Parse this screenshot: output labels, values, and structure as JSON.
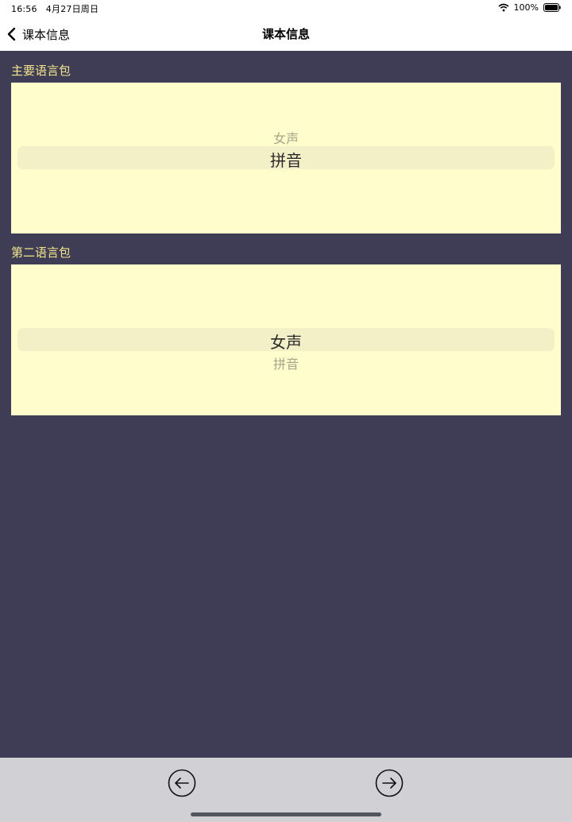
{
  "status_bar": {
    "time": "16:56",
    "date": "4月27日周日",
    "battery_percent": "100%",
    "wifi_icon": "wifi-icon",
    "battery_icon": "battery-full-icon"
  },
  "nav": {
    "back_label": "课本信息",
    "title": "课本信息",
    "back_icon": "chevron-left-icon"
  },
  "primary_pack": {
    "label": "主要语言包",
    "options": [
      "女声",
      "拼音"
    ],
    "selected": "拼音"
  },
  "secondary_pack": {
    "label": "第二语言包",
    "options": [
      "女声",
      "拼音"
    ],
    "selected": "女声"
  },
  "bottom": {
    "prev_icon": "arrow-left-circle-icon",
    "next_icon": "arrow-right-circle-icon"
  },
  "colors": {
    "background": "#3e3d55",
    "label": "#f3e58a",
    "picker_bg": "#fffdcc",
    "bottom_bar": "#d0d0d5"
  }
}
